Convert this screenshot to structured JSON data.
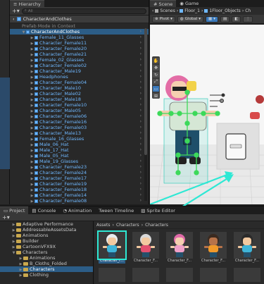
{
  "hierarchy": {
    "tab_label": "Hierarchy",
    "search_placeholder": "All",
    "prefab_title": "CharacterAndClothes",
    "items": [
      {
        "label": "Prefab Mode in Context",
        "kind": "grey"
      },
      {
        "label": "CharacterAndClothes",
        "kind": "sel"
      },
      {
        "label": "Female_11_Glasses"
      },
      {
        "label": "Character_Female11"
      },
      {
        "label": "Character_Female20"
      },
      {
        "label": "Character_Female21"
      },
      {
        "label": "Female_02_Glasses"
      },
      {
        "label": "Character_Female02"
      },
      {
        "label": "Character_Male19"
      },
      {
        "label": "Headphones"
      },
      {
        "label": "Character_Female04"
      },
      {
        "label": "Character_Male10"
      },
      {
        "label": "Character_Male02"
      },
      {
        "label": "Character_Male18"
      },
      {
        "label": "Character_Female10"
      },
      {
        "label": "Character_Male05"
      },
      {
        "label": "Character_Female06"
      },
      {
        "label": "Character_Female16"
      },
      {
        "label": "Character_Female03"
      },
      {
        "label": "Character_Male13"
      },
      {
        "label": "Female_16_Glasses"
      },
      {
        "label": "Male_06_Hat"
      },
      {
        "label": "Male_17_Hat"
      },
      {
        "label": "Male_05_Hat"
      },
      {
        "label": "Male_19_Glasses"
      },
      {
        "label": "Character_Female23"
      },
      {
        "label": "Character_Female24"
      },
      {
        "label": "Character_Female17"
      },
      {
        "label": "Character_Female19"
      },
      {
        "label": "Character_Female18"
      },
      {
        "label": "Character_Female14"
      },
      {
        "label": "Character_Female08"
      }
    ]
  },
  "scene": {
    "tabs": [
      {
        "label": "Scene"
      },
      {
        "label": "Game"
      }
    ],
    "breadcrumb": [
      "Scenes",
      "Floor_1",
      "1Floor_Objects",
      "Ch"
    ],
    "pivot": "Pivot",
    "global": "Global"
  },
  "project": {
    "tabs": [
      {
        "label": "Project"
      },
      {
        "label": "Console"
      },
      {
        "label": "Animation"
      },
      {
        "label": "Tween Timeline"
      },
      {
        "label": "Sprite Editor"
      }
    ],
    "breadcrumb": [
      "Assets",
      "Characters",
      "Characters"
    ],
    "tree": [
      {
        "label": "Adaptive Performance",
        "indent": 1
      },
      {
        "label": "AddressableAssetsData",
        "indent": 1
      },
      {
        "label": "Animations",
        "indent": 1
      },
      {
        "label": "Builder",
        "indent": 1
      },
      {
        "label": "CartoonVFX9X",
        "indent": 1
      },
      {
        "label": "Characters",
        "indent": 1,
        "open": true
      },
      {
        "label": "Animations",
        "indent": 2
      },
      {
        "label": "B_Cloths_Folded",
        "indent": 2
      },
      {
        "label": "Characters",
        "indent": 2,
        "sel": true
      },
      {
        "label": "Clothing",
        "indent": 2
      }
    ],
    "assets": [
      {
        "label": "Character_F...",
        "hair": "#e7ecef",
        "body": "#f2c9a0",
        "shirt": "#3fb5d9",
        "sel": true
      },
      {
        "label": "Character_F...",
        "hair": "#d8d8d8",
        "body": "#f2c9a0",
        "shirt": "#e2506f"
      },
      {
        "label": "Character_F...",
        "hair": "#e06aa8",
        "body": "#f5cfb0",
        "shirt": "#f0a0c8"
      },
      {
        "label": "Character_F...",
        "hair": "#3a2a20",
        "body": "#b7734a",
        "shirt": "#f19a2a"
      },
      {
        "label": "Character_F...",
        "hair": "#2a2a2a",
        "body": "#f2c9a0",
        "shirt": "#3fb5d9"
      }
    ]
  },
  "colors": {
    "accent": "#2c5d87",
    "hier_text": "#6fb8ff",
    "highlight": "#2ee8d4"
  }
}
